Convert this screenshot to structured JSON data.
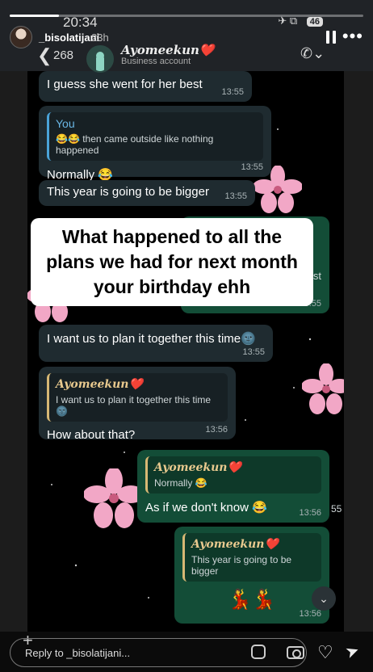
{
  "story": {
    "username": "_bisolatijani",
    "posted_time": "23h",
    "progress": 0.14,
    "reply_placeholder": "Reply to _bisolatijani..."
  },
  "whatsapp": {
    "status_time": "20:34",
    "battery": "46",
    "unread_count": "268",
    "contact_name": "Ayomeekun❤️",
    "contact_sub": "Business account"
  },
  "messages": {
    "m1_text": "I guess she went for her best",
    "m1_time": "13:55",
    "m2_quote_name": "You",
    "m2_quote_text": "😂😂 then came outside like nothing happened",
    "m2_text": "Normally 😂",
    "m2_time": "13:55",
    "m3_text": "This year is going to be bigger",
    "m3_time": "13:55",
    "m4_partial": "st",
    "m4_time": "13:55",
    "m5_text": "I want us to plan it together this time🌚",
    "m5_time": "13:55",
    "m6_quote_name": "Ayomeekun❤️",
    "m6_quote_text": "I want us to plan it together this time🌚",
    "m6_text": "How about that?",
    "m6_time": "13:56",
    "m7_quote_name": "Ayomeekun❤️",
    "m7_quote_text": "Normally 😂",
    "m7_text": "As if we don't know 😂",
    "m7_time": "13:56",
    "m7_edge": "55",
    "m8_quote_name": "Ayomeekun❤️",
    "m8_quote_text": "This year is going to be bigger",
    "m8_text": "💃💃",
    "m8_time": "13:56"
  },
  "caption": "What happened to all the plans we had for next month your birthday ehh",
  "colors": {
    "incoming": "#1f2b30",
    "outgoing": "#134d37",
    "flower": "#f2a7c6"
  }
}
